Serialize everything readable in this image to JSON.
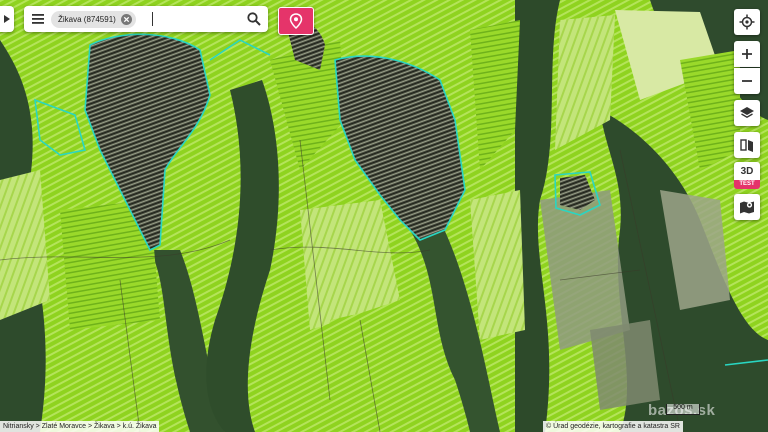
{
  "search": {
    "chip_label": "Žikava (874591)",
    "query": ""
  },
  "controls": {
    "threed_label": "3D",
    "test_badge": "TEST"
  },
  "footer": {
    "breadcrumb": "Nitriansky > Zlaté Moravce > Žikava > k.ú. Žikava",
    "attribution": "© Úrad geodézie, kartografie a katastra SR",
    "scale_label": "500 m",
    "watermark": "bazos.sk"
  },
  "colors": {
    "forest": "#2e4b2c",
    "field_bright": "#8fd31f",
    "field_light": "#b9e36a",
    "field_pale": "#d8e9a4",
    "boundary": "#29d6c2",
    "accent": "#e5346a",
    "road": "#3a3a2a"
  },
  "icons": {
    "menu": "menu-icon",
    "chip_clear": "clear-icon",
    "search": "search-icon",
    "pin": "map-pin-icon",
    "locate": "locate-icon",
    "zoom_in": "plus-icon",
    "zoom_out": "minus-icon",
    "layers": "layers-icon",
    "split": "split-view-icon",
    "map_marker": "map-marker-icon"
  }
}
